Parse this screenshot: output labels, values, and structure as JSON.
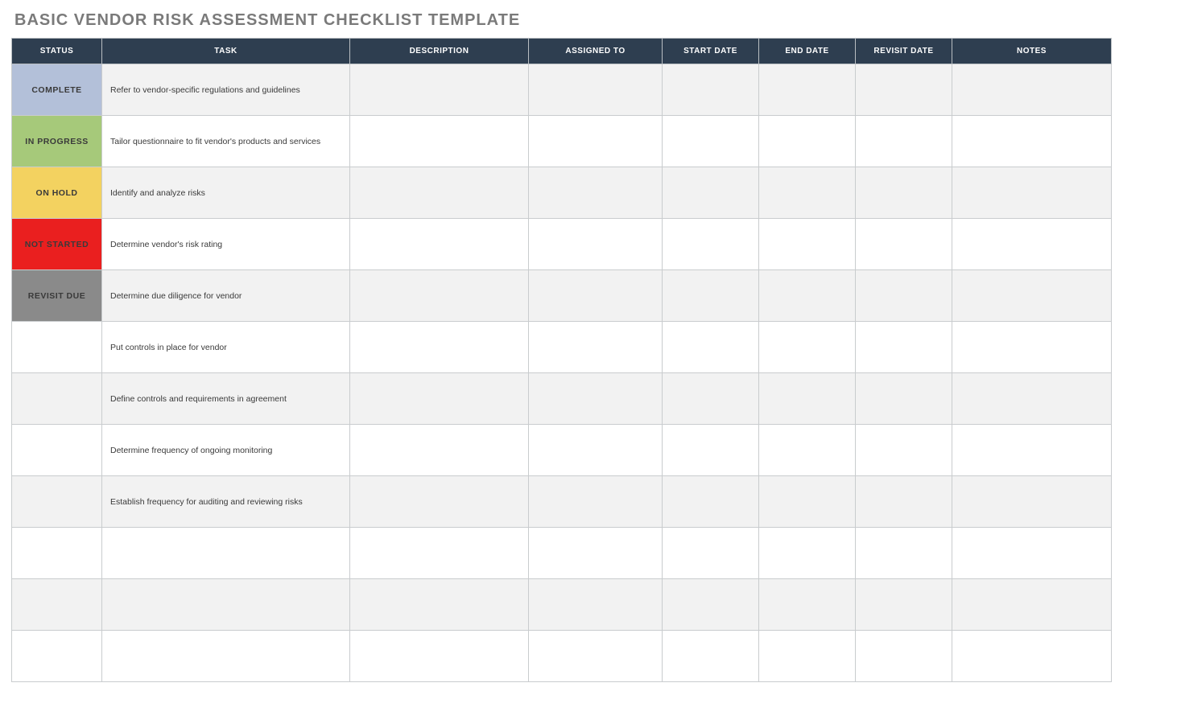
{
  "title": "BASIC VENDOR RISK ASSESSMENT CHECKLIST TEMPLATE",
  "columns": {
    "status": "STATUS",
    "task": "TASK",
    "desc": "DESCRIPTION",
    "assigned": "ASSIGNED TO",
    "sdate": "START DATE",
    "edate": "END DATE",
    "rdate": "REVISIT DATE",
    "notes": "NOTES"
  },
  "status_styles": {
    "COMPLETE": "status-complete",
    "IN PROGRESS": "status-in-progress",
    "ON HOLD": "status-on-hold",
    "NOT STARTED": "status-not-started",
    "REVISIT DUE": "status-revisit-due"
  },
  "rows": [
    {
      "status": "COMPLETE",
      "task": "Refer to vendor-specific regulations and guidelines",
      "desc": "",
      "assigned": "",
      "sdate": "",
      "edate": "",
      "rdate": "",
      "notes": ""
    },
    {
      "status": "IN PROGRESS",
      "task": "Tailor questionnaire to fit vendor's products and services",
      "desc": "",
      "assigned": "",
      "sdate": "",
      "edate": "",
      "rdate": "",
      "notes": ""
    },
    {
      "status": "ON HOLD",
      "task": "Identify and analyze risks",
      "desc": "",
      "assigned": "",
      "sdate": "",
      "edate": "",
      "rdate": "",
      "notes": ""
    },
    {
      "status": "NOT STARTED",
      "task": "Determine vendor's risk rating",
      "desc": "",
      "assigned": "",
      "sdate": "",
      "edate": "",
      "rdate": "",
      "notes": ""
    },
    {
      "status": "REVISIT DUE",
      "task": "Determine due diligence for vendor",
      "desc": "",
      "assigned": "",
      "sdate": "",
      "edate": "",
      "rdate": "",
      "notes": ""
    },
    {
      "status": "",
      "task": "Put controls in place for vendor",
      "desc": "",
      "assigned": "",
      "sdate": "",
      "edate": "",
      "rdate": "",
      "notes": ""
    },
    {
      "status": "",
      "task": "Define controls and requirements in agreement",
      "desc": "",
      "assigned": "",
      "sdate": "",
      "edate": "",
      "rdate": "",
      "notes": ""
    },
    {
      "status": "",
      "task": "Determine frequency of ongoing monitoring",
      "desc": "",
      "assigned": "",
      "sdate": "",
      "edate": "",
      "rdate": "",
      "notes": ""
    },
    {
      "status": "",
      "task": "Establish frequency for auditing and reviewing risks",
      "desc": "",
      "assigned": "",
      "sdate": "",
      "edate": "",
      "rdate": "",
      "notes": ""
    },
    {
      "status": "",
      "task": "",
      "desc": "",
      "assigned": "",
      "sdate": "",
      "edate": "",
      "rdate": "",
      "notes": ""
    },
    {
      "status": "",
      "task": "",
      "desc": "",
      "assigned": "",
      "sdate": "",
      "edate": "",
      "rdate": "",
      "notes": ""
    },
    {
      "status": "",
      "task": "",
      "desc": "",
      "assigned": "",
      "sdate": "",
      "edate": "",
      "rdate": "",
      "notes": ""
    }
  ]
}
